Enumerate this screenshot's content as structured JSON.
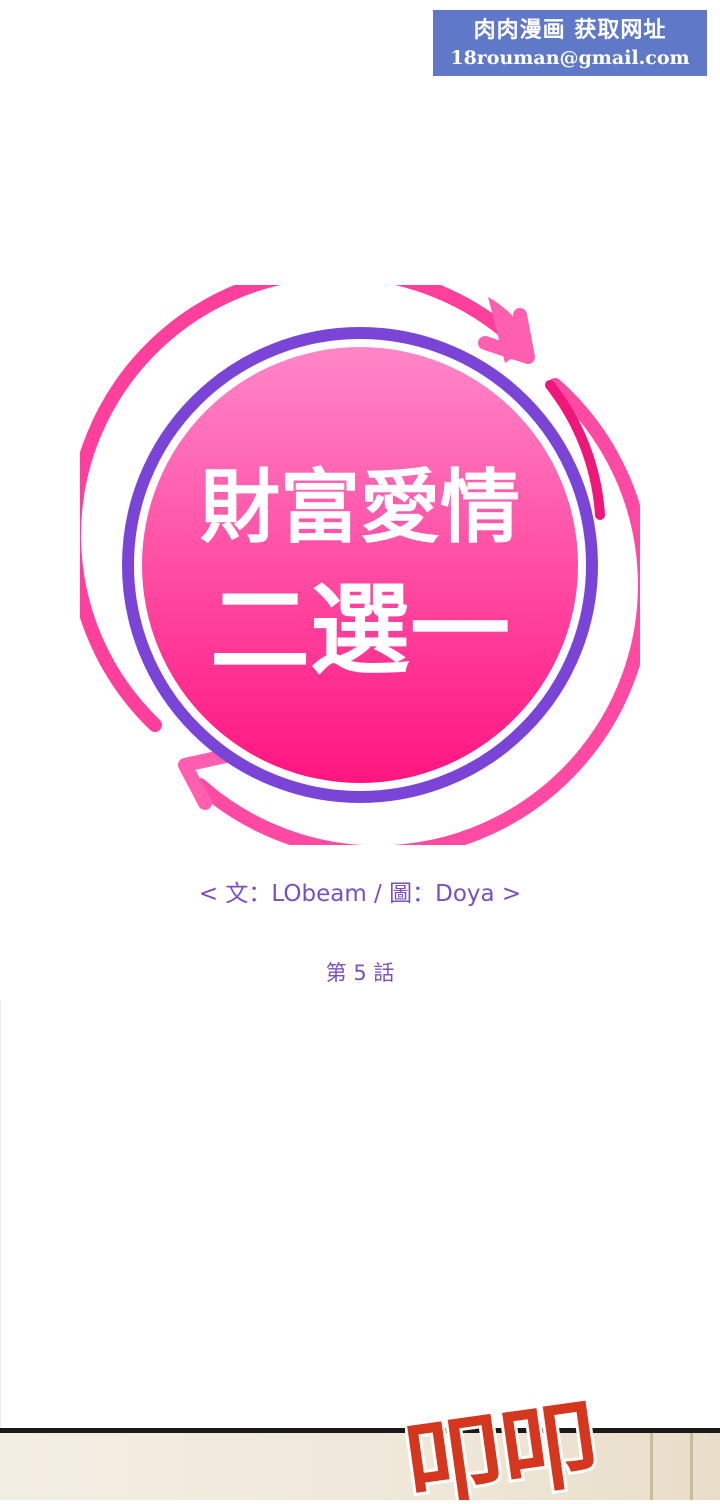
{
  "watermark": {
    "line1": "肉肉漫画  获取网址",
    "line2": "18rouman@gmail.com"
  },
  "logo": {
    "title_line1": "財富愛情",
    "title_line2": "二選一",
    "colors": {
      "outer_ring": "#ff4fa6",
      "inner_ring": "#7a45d6",
      "fill_top": "#ff7cc2",
      "fill_bottom": "#ff1f86"
    }
  },
  "credit": "< 文：LObeam  /  圖：Doya >",
  "chapter": "第 5 話",
  "sfx": "叩叩"
}
